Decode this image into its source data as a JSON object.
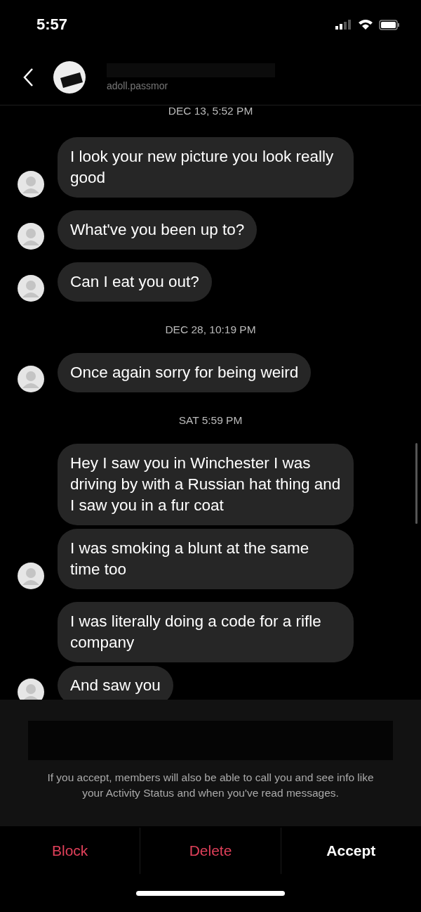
{
  "status_bar": {
    "time": "5:57"
  },
  "header": {
    "handle": "adoll.passmor"
  },
  "thread": [
    {
      "kind": "timestamp",
      "text": "DEC 13, 5:52 PM"
    },
    {
      "kind": "message",
      "text": "I look your new picture you look really good",
      "avatar": true
    },
    {
      "kind": "message",
      "text": "What've you been up to?",
      "avatar": true
    },
    {
      "kind": "message",
      "text": "Can I eat you out?",
      "avatar": true
    },
    {
      "kind": "timestamp",
      "text": "DEC 28, 10:19 PM"
    },
    {
      "kind": "message",
      "text": "Once again sorry for being weird",
      "avatar": true
    },
    {
      "kind": "timestamp",
      "text": "SAT 5:59 PM"
    },
    {
      "kind": "message",
      "text": "Hey I saw you in Winchester I was driving by with a Russian hat thing and I saw you in a fur coat",
      "avatar": false
    },
    {
      "kind": "message",
      "text": "I was smoking a blunt at the same time too",
      "avatar": true
    },
    {
      "kind": "message",
      "text": "I was literally doing a code for a rifle company",
      "avatar": false
    },
    {
      "kind": "message",
      "text": "And saw you",
      "avatar": true
    }
  ],
  "request": {
    "info": "If you accept, members will also be able to call you and see info like your Activity Status and when you've read messages."
  },
  "actions": [
    {
      "label": "Block",
      "kind": "danger"
    },
    {
      "label": "Delete",
      "kind": "danger"
    },
    {
      "label": "Accept",
      "kind": "primary"
    }
  ]
}
